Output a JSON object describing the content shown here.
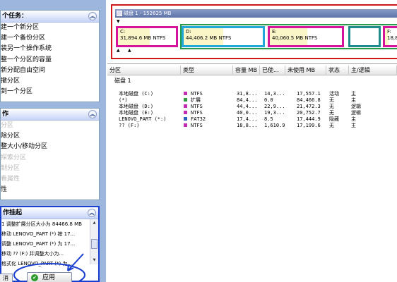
{
  "left": {
    "tasks_header": "个任务：",
    "tasks": [
      "建一个新分区",
      "建一个备份分区",
      "装另一个操作系统",
      "整一个分区的容量",
      "新分配自由空间",
      "撤分区",
      "到一个分区"
    ],
    "ops_header": "作",
    "ops": [
      {
        "label": "分区",
        "enabled": false
      },
      {
        "label": "除分区",
        "enabled": true
      },
      {
        "label": "整大小/移动分区",
        "enabled": true
      },
      {
        "label": "探索分区",
        "enabled": false
      },
      {
        "label": "制分区",
        "enabled": false
      },
      {
        "label": "看属性",
        "enabled": false
      },
      {
        "label": "性",
        "enabled": true
      }
    ],
    "pending_header": "作挂起",
    "pending": [
      "1 调整扩展分区大小为 84466.8 MB",
      "移动 LENOVO_PART (*) 按 17...",
      "调整 LENOVO_PART (*) 为 17...",
      "移动 ?? (F:) 并调整大小为...",
      "格式化 LENOVO_PART (*) 为..."
    ],
    "btn_left": "消",
    "btn_apply": "应用",
    "apply_icon": "check-circle-icon",
    "collapse_icon": "chevron-double-up-icon"
  },
  "map": {
    "disk_title": "磁盘 1 - 152625 MB",
    "partitions": [
      {
        "letter": "C:",
        "info": "31,894.6 MB   NTFS",
        "border": "#d4149b",
        "fill_ratio": 0.55
      },
      {
        "letter": "D:",
        "info": "44,406.2 MB   NTFS",
        "border": "#22a8d8",
        "fill_ratio": 0.5
      },
      {
        "letter": "E:",
        "info": "40,060.5 MB   NTFS",
        "border": "#d4149b",
        "fill_ratio": 0.52
      },
      {
        "letter": "",
        "info": "",
        "border": "#1e8c8c",
        "fill_ratio": 0
      },
      {
        "letter": "F:",
        "info": "18,87",
        "border": "#d4149b",
        "fill_ratio": 0.3
      }
    ]
  },
  "list": {
    "columns": [
      "分区",
      "类型",
      "容量 MB",
      "已使...",
      "未使用 MB",
      "状态",
      "主/逻辑"
    ],
    "disk_label": "磁盘 1",
    "rows": [
      {
        "name": "本地磁盘 (C:)",
        "type": "NTFS",
        "color": "#c02cb4",
        "size": "31,8...",
        "used": "14,3...",
        "unused": "17,557.1",
        "status": "活动",
        "kind": "主"
      },
      {
        "name": "(*)",
        "type": "扩展",
        "color": "#2c9c3c",
        "size": "84,4...",
        "used": "0.0",
        "unused": "84,466.8",
        "status": "无",
        "kind": "主"
      },
      {
        "name": "本地磁盘 (D:)",
        "type": "NTFS",
        "color": "#c02cb4",
        "size": "44,4...",
        "used": "22,9...",
        "unused": "21,472.3",
        "status": "无",
        "kind": "逻辑"
      },
      {
        "name": "本地磁盘 (E:)",
        "type": "NTFS",
        "color": "#c02cb4",
        "size": "40,0...",
        "used": "19,3...",
        "unused": "20,752.7",
        "status": "无",
        "kind": "逻辑"
      },
      {
        "name": "LENOVO_PART (*:)",
        "type": "FAT32",
        "color": "#2a5fbe",
        "size": "17,4...",
        "used": "8.5",
        "unused": "17,444.9",
        "status": "隐藏",
        "kind": "主"
      },
      {
        "name": "?? (F:)",
        "type": "NTFS",
        "color": "#c02cb4",
        "size": "18,8...",
        "used": "1,610.9",
        "unused": "17,199.6",
        "status": "无",
        "kind": "主"
      }
    ]
  }
}
